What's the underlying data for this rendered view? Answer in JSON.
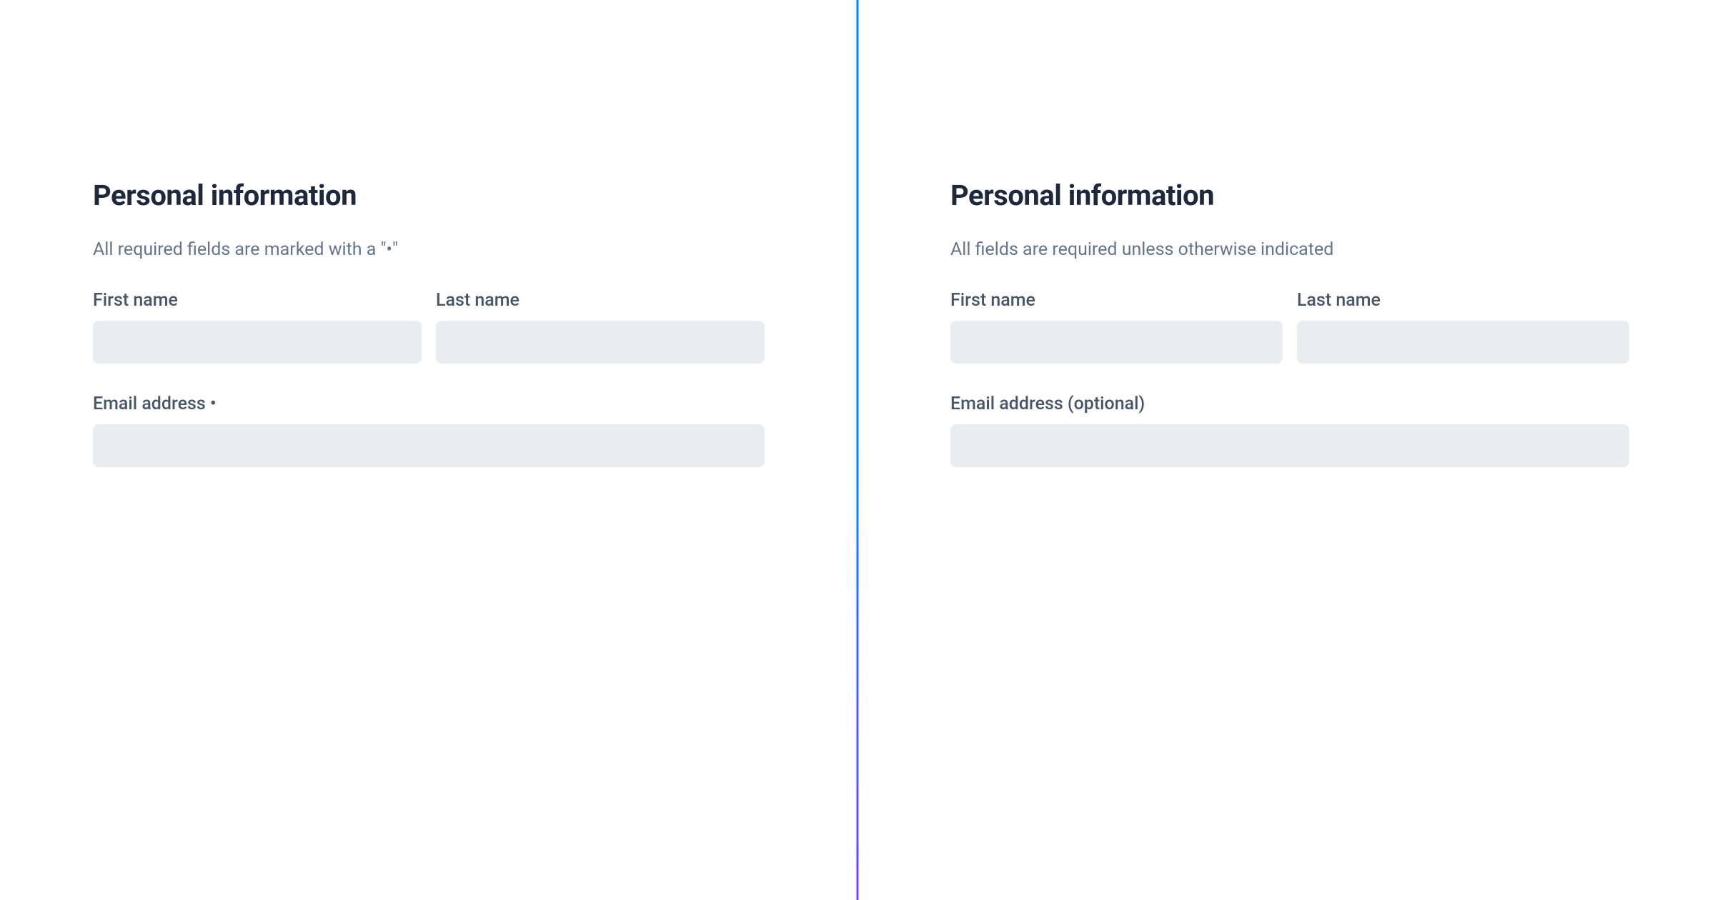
{
  "left": {
    "heading": "Personal information",
    "helper": "All required fields are marked with a \"•\"",
    "fields": {
      "first_name_label": "First name",
      "last_name_label": "Last name",
      "email_label": "Email address •"
    }
  },
  "right": {
    "heading": "Personal information",
    "helper": "All fields are required unless otherwise indicated",
    "fields": {
      "first_name_label": "First name",
      "last_name_label": "Last name",
      "email_label": "Email address (optional)"
    }
  }
}
